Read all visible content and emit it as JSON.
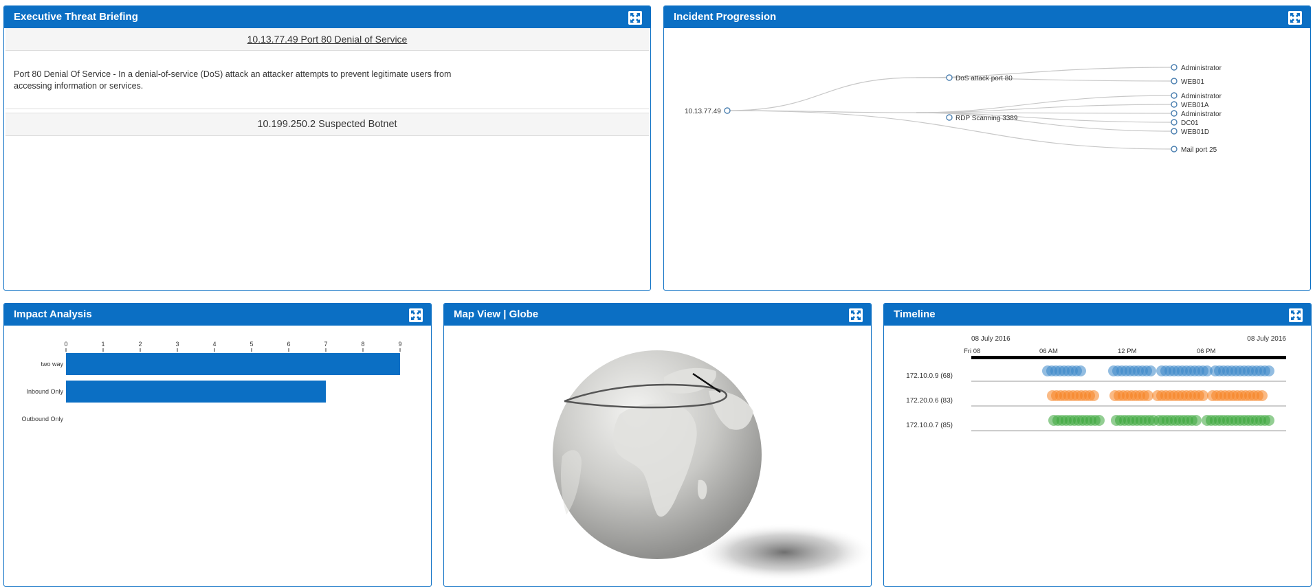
{
  "panels": {
    "briefing": {
      "title": "Executive Threat Briefing"
    },
    "progression": {
      "title": "Incident Progression"
    },
    "impact": {
      "title": "Impact Analysis"
    },
    "map": {
      "title": "Map View | Globe"
    },
    "timeline": {
      "title": "Timeline"
    }
  },
  "briefing": {
    "incident1": "10.13.77.49 Port 80 Denial of Service",
    "description": "Port 80 Denial Of Service - In a denial-of-service (DoS) attack an attacker attempts to prevent legitimate users from accessing information or services.",
    "incident2": "10.199.250.2 Suspected Botnet"
  },
  "progression": {
    "root": "10.13.77.49",
    "nodes": {
      "dos": "DoS attack port 80",
      "rdp": "RDP Scanning 3389",
      "admin1": "Administrator",
      "web01": "WEB01",
      "admin2": "Administrator",
      "web01a": "WEB01A",
      "admin3": "Administrator",
      "dc01": "DC01",
      "web01d": "WEB01D",
      "mail": "Mail port 25"
    }
  },
  "impact": {
    "chart_data": {
      "type": "bar",
      "orientation": "horizontal",
      "categories": [
        "two way",
        "Inbound Only",
        "Outbound Only"
      ],
      "values": [
        9,
        7,
        0
      ],
      "xlim": [
        0,
        9
      ],
      "ticks": [
        "0",
        "1",
        "2",
        "3",
        "4",
        "5",
        "6",
        "7",
        "8",
        "9"
      ],
      "color": "#0b6fc4"
    }
  },
  "timeline": {
    "date_left": "08 July 2016",
    "date_right": "08 July 2016",
    "ticks": [
      "Fri 08",
      "06 AM",
      "12 PM",
      "06 PM"
    ],
    "rows": [
      {
        "label": "172.10.0.9 (68)",
        "color": "#3a87c8"
      },
      {
        "label": "172.20.0.6 (83)",
        "color": "#f58220"
      },
      {
        "label": "172.10.0.7 (85)",
        "color": "#3aa63a"
      }
    ]
  },
  "icons": {
    "expand": "expand-icon"
  }
}
